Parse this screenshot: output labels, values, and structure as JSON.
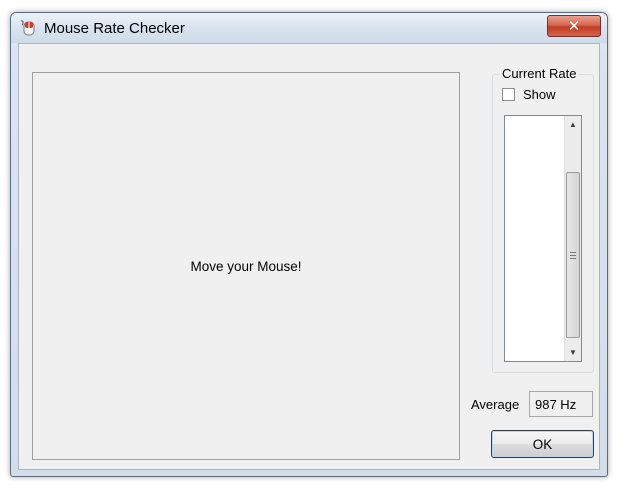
{
  "window": {
    "title": "Mouse Rate Checker",
    "close_glyph": "✕",
    "accent": "#c13b24"
  },
  "main": {
    "prompt": "Move your Mouse!"
  },
  "current_rate": {
    "group_title": "Current Rate",
    "show_label": "Show",
    "show_checked": false,
    "list_items": []
  },
  "average": {
    "label": "Average",
    "value": "987 Hz"
  },
  "buttons": {
    "ok_label": "OK"
  },
  "icons": {
    "app": "mouse-app-icon",
    "close": "close-icon",
    "scroll_up": "scroll-up-arrow-icon",
    "scroll_down": "scroll-down-arrow-icon"
  }
}
